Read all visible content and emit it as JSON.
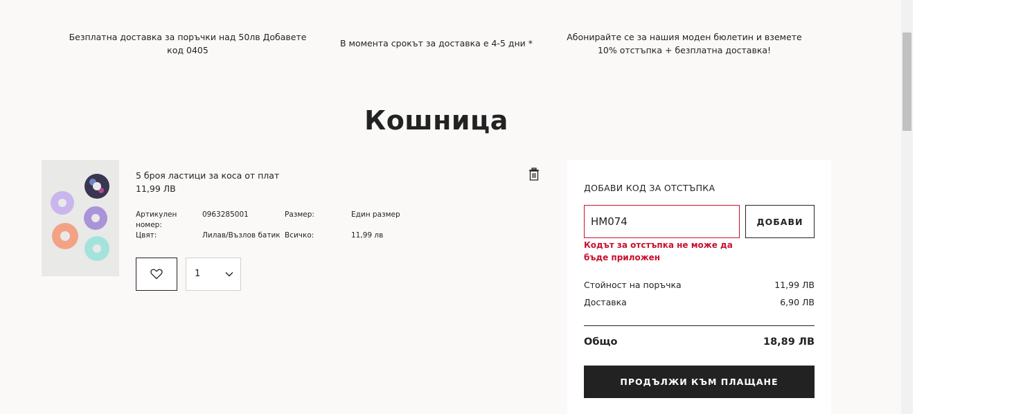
{
  "banners": [
    "Безплатна доставка за поръчки над 50лв Добавете код 0405",
    "В момента срокът за доставка е 4-5 дни *",
    "Абонирайте се за нашия моден бюлетин и вземете 10% отстъпка + безплатна доставка!"
  ],
  "page_title": "Кошница",
  "product": {
    "name": "5 броя ластици за коса от плат",
    "price": "11,99 ЛВ",
    "attributes": {
      "article_label": "Артикулен номер:",
      "article_value": "0963285001",
      "size_label": "Размер:",
      "size_value": "Един размер",
      "color_label": "Цвят:",
      "color_value": "Лилав/Възлов батик",
      "total_label": "Всичко:",
      "total_value": "11,99 лв"
    },
    "quantity": "1",
    "icons": {
      "delete": "trash-icon",
      "wishlist": "heart-icon",
      "quantity": "chevron-down-icon"
    }
  },
  "summary": {
    "discount_heading": "ДОБАВИ КОД ЗА ОТСТЪПКА",
    "discount_code_value": "HM074",
    "add_button": "ДОБАВИ",
    "error_message": "Кодът за отстъпка не може да бъде приложен",
    "order_value_label": "Стойност на поръчка",
    "order_value": "11,99 ЛВ",
    "delivery_label": "Доставка",
    "delivery_value": "6,90 ЛВ",
    "total_label": "Общо",
    "total_value": "18,89 ЛВ",
    "checkout_button": "ПРОДЪЛЖИ КЪМ ПЛАЩАНЕ"
  },
  "colors": {
    "page_background": "#faf9f8",
    "error_red": "#c8102e",
    "primary_dark": "#222222"
  }
}
